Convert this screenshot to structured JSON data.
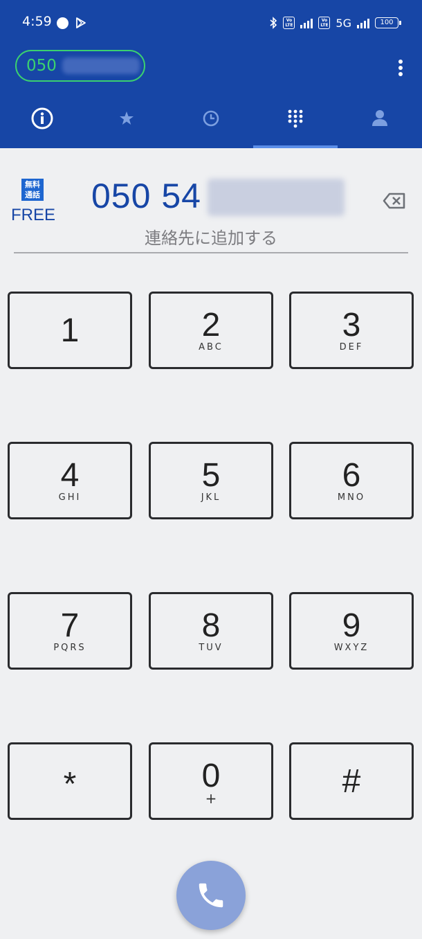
{
  "status_bar": {
    "time": "4:59",
    "network": "5G",
    "battery": "100",
    "volte_label": "Vo LTE"
  },
  "header": {
    "account_number": "050",
    "tabs": [
      {
        "name": "info",
        "icon": "info-icon"
      },
      {
        "name": "favorites",
        "icon": "star-icon"
      },
      {
        "name": "history",
        "icon": "clock-icon"
      },
      {
        "name": "keypad",
        "icon": "dialpad-icon",
        "active": true
      },
      {
        "name": "contacts",
        "icon": "person-icon"
      }
    ]
  },
  "dialer": {
    "free_badge": "無料\n通話",
    "free_badge_top": "無料",
    "free_badge_bottom": "通話",
    "free_label": "FREE",
    "dialed_number": "050 54",
    "add_contact": "連絡先に追加する"
  },
  "keypad": {
    "keys": [
      {
        "digit": "1",
        "letters": ""
      },
      {
        "digit": "2",
        "letters": "ABC"
      },
      {
        "digit": "3",
        "letters": "DEF"
      },
      {
        "digit": "4",
        "letters": "GHI"
      },
      {
        "digit": "5",
        "letters": "JKL"
      },
      {
        "digit": "6",
        "letters": "MNO"
      },
      {
        "digit": "7",
        "letters": "PQRS"
      },
      {
        "digit": "8",
        "letters": "TUV"
      },
      {
        "digit": "9",
        "letters": "WXYZ"
      },
      {
        "digit": "*",
        "letters": ""
      },
      {
        "digit": "0",
        "letters": "+"
      },
      {
        "digit": "#",
        "letters": ""
      }
    ]
  },
  "colors": {
    "header_bg": "#1746a6",
    "accent_green": "#3bd16f",
    "number_blue": "#1746a6",
    "call_button": "#8aa2d9",
    "background": "#eff0f2"
  }
}
